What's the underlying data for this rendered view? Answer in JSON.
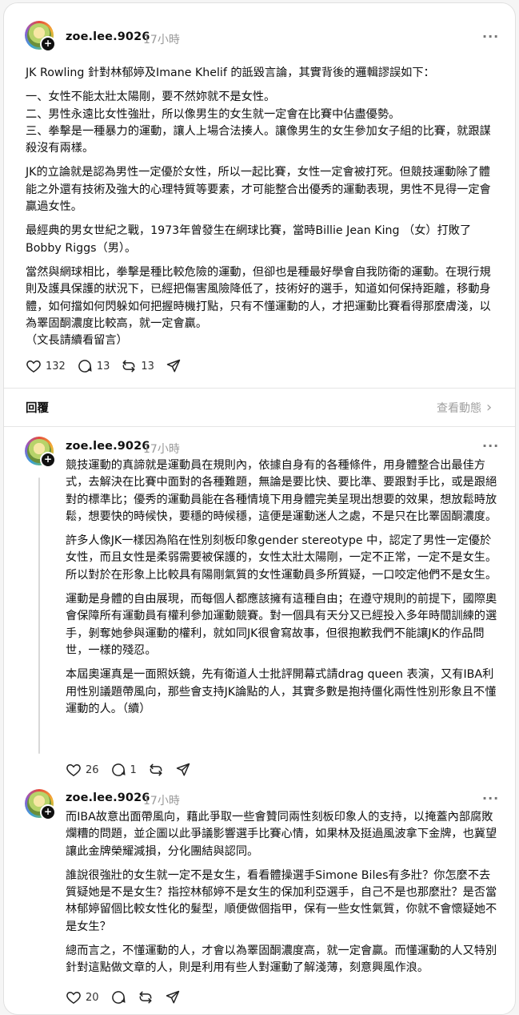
{
  "posts": [
    {
      "username": "zoe.lee.9026",
      "time": "17小時",
      "more_glyph": "···",
      "paragraphs": [
        "JK Rowling 針對林郁婷及Imane Khelif 的詆毀言論，其實背後的邏輯謬誤如下：",
        "一、女性不能太壯太陽剛，要不然妳就不是女性。\n二、男性永遠比女性強壯，所以像男生的女生就一定會在比賽中佔盡優勢。\n三、拳擊是一種暴力的運動，讓人上場合法揍人。讓像男生的女生參加女子組的比賽，就跟謀殺沒有兩樣。",
        "JK的立論就是認為男性一定優於女性，所以一起比賽，女性一定會被打死。但競技運動除了體能之外還有技術及強大的心理特質等要素，才可能整合出優秀的運動表現，男性不見得一定會贏過女性。",
        "最經典的男女世紀之戰，1973年曾發生在網球比賽，當時Billie Jean King （女）打敗了Bobby Riggs（男）。",
        "當然與網球相比，拳擊是種比較危險的運動，但卻也是種最好學會自我防衛的運動。在現行規則及護具保護的狀況下，已經把傷害風險降低了，技術好的選手，知道如何保持距離，移動身體，如何擋如何閃躲如何把握時機打點，只有不懂運動的人，才把運動比賽看得那麼膚淺，以為睪固酮濃度比較高，就一定會贏。\n（文長請續看留言）"
      ],
      "likes": "132",
      "comments": "13",
      "reposts": "13"
    },
    {
      "username": "zoe.lee.9026",
      "time": "17小時",
      "more_glyph": "···",
      "paragraphs": [
        "競技運動的真諦就是運動員在規則內，依據自身有的各種條件，用身體整合出最佳方式，去解決在比賽中面對的各種難題，無論是要比快、要比準、要跟對手比，或是跟絕對的標準比；優秀的運動員能在各種情境下用身體完美呈現出想要的效果，想放鬆時放鬆，想要快的時候快，要穩的時候穩，這便是運動迷人之處，不是只在比睪固酮濃度。",
        "許多人像JK一樣因為陷在性別刻板印象gender stereotype 中，認定了男性一定優於女性，而且女性是柔弱需要被保護的，女性太壯太陽剛，一定不正常，一定不是女生。所以對於在形象上比較具有陽剛氣質的女性運動員多所質疑，一口咬定他們不是女生。",
        "運動是身體的自由展現，而每個人都應該擁有這種自由；在遵守規則的前提下，國際奧會保障所有運動員有權利參加運動競賽。對一個具有天分又已經投入多年時間訓練的選手，剝奪她參與運動的權利，就如同JK很會寫故事，但很抱歉我們不能讓JK的作品問世，一樣的殘忍。",
        "本屆奧運真是一面照妖鏡，先有衛道人士批評開幕式請drag queen 表演，又有IBA利用性別議題帶風向，那些會支持JK論點的人，其實多數是抱持僵化兩性性別形象且不懂運動的人。（續）"
      ],
      "likes": "26",
      "comments": "1"
    },
    {
      "username": "zoe.lee.9026",
      "time": "17小時",
      "more_glyph": "···",
      "paragraphs": [
        "而IBA故意出面帶風向，藉此爭取一些會贊同兩性刻板印象人的支持，以掩蓋內部腐敗爛糟的問題，並企圖以此爭議影響選手比賽心情，如果林及挺過風波拿下金牌，也冀望讓此金牌榮耀減損，分化團結與認同。",
        "誰說很強壯的女生就一定不是女生，看看體操選手Simone Biles有多壯？你怎麼不去質疑她是不是女生？指控林郁婷不是女生的保加利亞選手，自己不是也那麼壯？是否當林郁婷留個比較女性化的髮型，順便做個指甲，保有一些女性氣質，你就不會懷疑她不是女生？",
        "總而言之，不懂運動的人，才會以為睪固酮濃度高，就一定會贏。而懂運動的人又特別針對這點做文章的人，則是利用有些人對運動了解淺薄，刻意興風作浪。"
      ],
      "likes": "20"
    }
  ],
  "reply_bar": {
    "reply_label": "回覆",
    "activity_label": "查看動態",
    "activity_chevron": "›"
  },
  "avatar_badge": "+"
}
